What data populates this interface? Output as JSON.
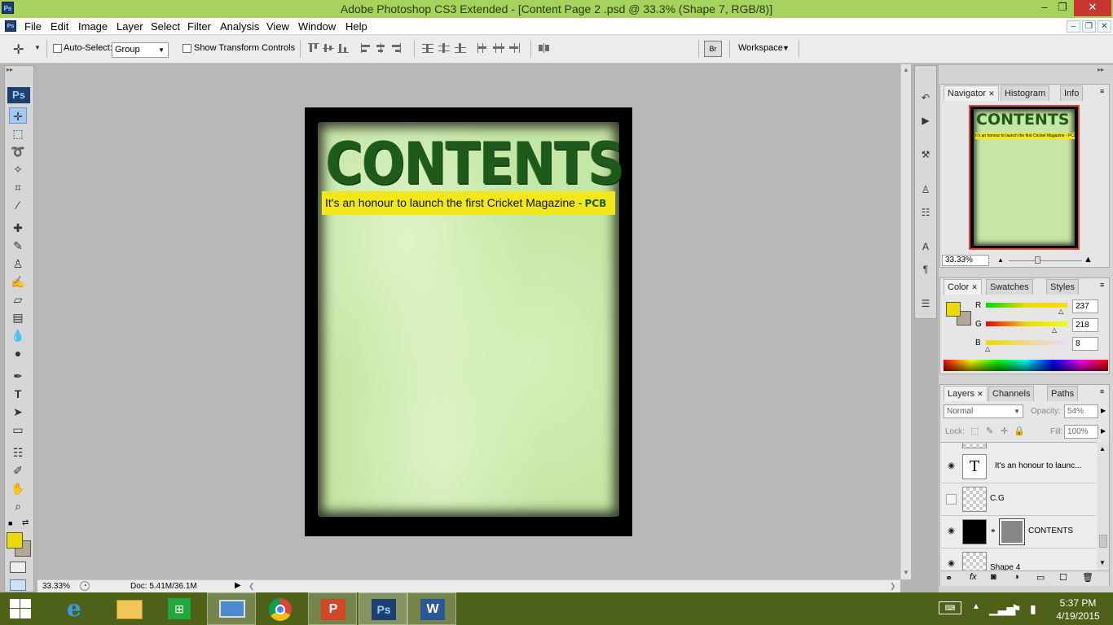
{
  "window": {
    "title": "Adobe Photoshop CS3 Extended - [Content Page 2 .psd @ 33.3% (Shape 7, RGB/8)]",
    "app_icon": "Ps",
    "controls": [
      "minimize",
      "restore",
      "close"
    ]
  },
  "menu": [
    "File",
    "Edit",
    "Image",
    "Layer",
    "Select",
    "Filter",
    "Analysis",
    "View",
    "Window",
    "Help"
  ],
  "options": {
    "auto_select_label": "Auto-Select:",
    "auto_select_checked": false,
    "group_value": "Group",
    "show_transform_label": "Show Transform Controls",
    "show_transform_checked": false,
    "workspace_label": "Workspace"
  },
  "tools": {
    "ps_logo": "Ps",
    "list": [
      "move",
      "marquee",
      "lasso",
      "magic-wand",
      "crop",
      "slice",
      "healing",
      "brush",
      "stamp",
      "history-brush",
      "eraser",
      "gradient",
      "blur",
      "dodge",
      "pen",
      "type",
      "path-select",
      "shape",
      "notes",
      "eyedropper",
      "hand",
      "zoom"
    ],
    "foreground_color": "#edda08",
    "background_color": "#b3a898"
  },
  "document": {
    "heading": "CONTENTS",
    "banner_text": "It's an honour to launch the first Cricket Magazine -",
    "banner_tag": "PCB"
  },
  "status": {
    "zoom": "33.33%",
    "doc_size": "Doc: 5.41M/36.1M"
  },
  "navigator": {
    "tabs": [
      "Navigator",
      "Histogram",
      "Info"
    ],
    "zoom": "33.33%",
    "thumb_heading": "CONTENTS",
    "thumb_banner": "It's an honour to launch the first Cricket Magazine - PCB"
  },
  "color_panel": {
    "tabs": [
      "Color",
      "Swatches",
      "Styles"
    ],
    "channels": [
      {
        "label": "R",
        "value": "237",
        "fraction": 0.93
      },
      {
        "label": "G",
        "value": "218",
        "fraction": 0.85
      },
      {
        "label": "B",
        "value": "8",
        "fraction": 0.03
      }
    ]
  },
  "layers_panel": {
    "tabs": [
      "Layers",
      "Channels",
      "Paths"
    ],
    "blend_mode": "Normal",
    "opacity_label": "Opacity:",
    "opacity": "54%",
    "lock_label": "Lock:",
    "fill_label": "Fill:",
    "fill": "100%",
    "layers": [
      {
        "name": "It's an honour to launc...",
        "visible": true,
        "type": "text"
      },
      {
        "name": "C.G",
        "visible": false,
        "type": "pixel"
      },
      {
        "name": "CONTENTS",
        "visible": true,
        "type": "adjustment"
      },
      {
        "name": "Shape 4",
        "visible": true,
        "type": "pixel"
      }
    ]
  },
  "taskbar": {
    "apps": [
      "Internet Explorer",
      "File Explorer",
      "Store",
      "Remote Desktop",
      "Chrome",
      "PowerPoint",
      "Photoshop",
      "Word"
    ],
    "active_app": "Photoshop",
    "time": "5:37 PM",
    "date": "4/19/2015"
  }
}
